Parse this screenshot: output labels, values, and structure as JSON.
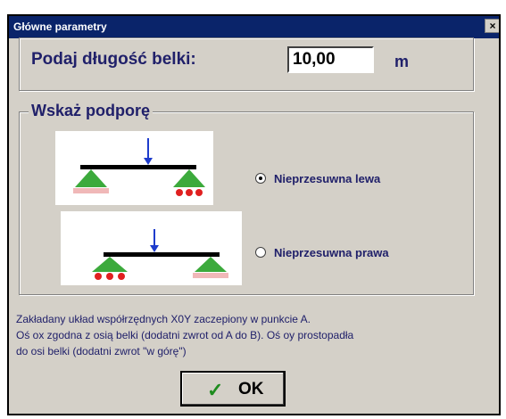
{
  "window": {
    "title": "Główne parametry",
    "close_glyph": "×"
  },
  "length": {
    "label": "Podaj długość belki:",
    "value": "10,00",
    "unit": "m"
  },
  "support": {
    "legend": "Wskaż podporę",
    "options": [
      {
        "label": "Nieprzesuwna lewa",
        "selected": true,
        "diagram": "fixed-support-left"
      },
      {
        "label": "Nieprzesuwna prawa",
        "selected": false,
        "diagram": "fixed-support-right"
      }
    ]
  },
  "info": {
    "lines": [
      "Zakładany układ współrzędnych X0Y zaczepiony w punkcie A.",
      "Oś ox zgodna z osią belki (dodatni zwrot od A do B). Oś oy prostopadła",
      "do osi belki (dodatni zwrot \"w górę\")"
    ]
  },
  "ok_button": {
    "label": "OK",
    "icon": "checkmark-icon"
  },
  "colors": {
    "titlebar": "#0a246a",
    "face": "#d4d0c8",
    "label_text": "#20206a",
    "support_green": "#3caa3c",
    "roller_red": "#e02020",
    "load_arrow": "#1e3ccc"
  }
}
